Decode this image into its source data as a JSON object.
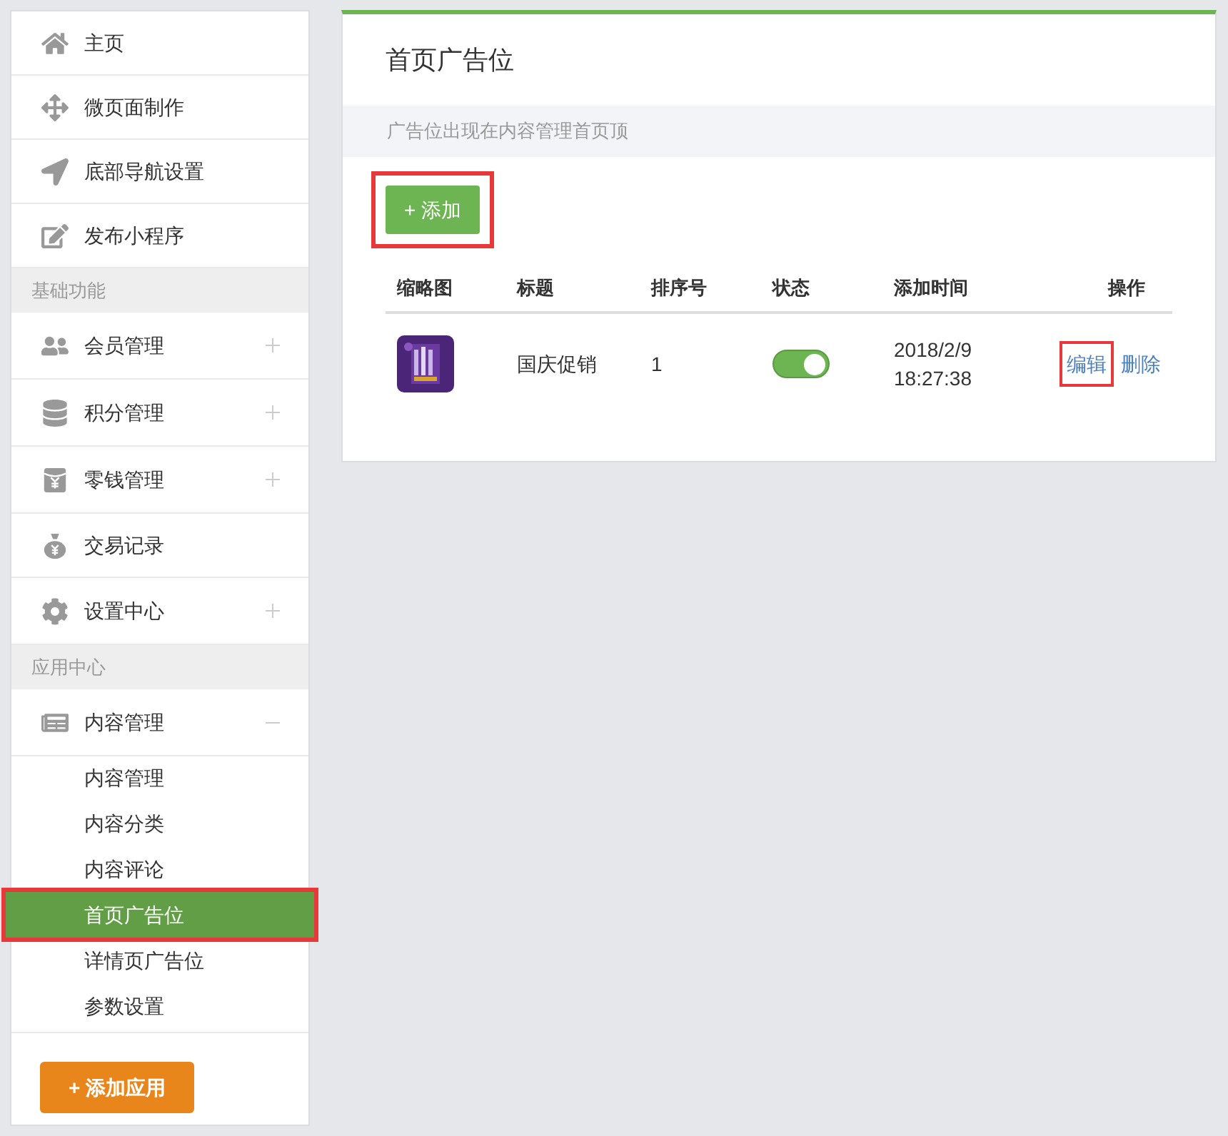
{
  "sidebar": {
    "entries": [
      {
        "kind": "item",
        "label": "主页"
      },
      {
        "kind": "item",
        "label": "微页面制作"
      },
      {
        "kind": "item",
        "label": "底部导航设置"
      },
      {
        "kind": "item",
        "label": "发布小程序"
      },
      {
        "kind": "section",
        "label": "基础功能"
      },
      {
        "kind": "item",
        "label": "会员管理",
        "expanded": false
      },
      {
        "kind": "item",
        "label": "积分管理",
        "expanded": false
      },
      {
        "kind": "item",
        "label": "零钱管理",
        "expanded": false
      },
      {
        "kind": "item",
        "label": "交易记录"
      },
      {
        "kind": "item",
        "label": "设置中心",
        "expanded": false
      },
      {
        "kind": "section",
        "label": "应用中心"
      },
      {
        "kind": "item",
        "label": "内容管理",
        "expanded": true,
        "children": [
          {
            "label": "内容管理",
            "selected": false,
            "highlighted": false
          },
          {
            "label": "内容分类",
            "selected": false,
            "highlighted": false
          },
          {
            "label": "内容评论",
            "selected": false,
            "highlighted": false
          },
          {
            "label": "首页广告位",
            "selected": true,
            "highlighted": true
          },
          {
            "label": "详情页广告位",
            "selected": false,
            "highlighted": false
          },
          {
            "label": "参数设置",
            "selected": false,
            "highlighted": false
          }
        ]
      }
    ],
    "add_app_button": "+ 添加应用"
  },
  "main": {
    "title": "首页广告位",
    "notice": "广告位出现在内容管理首页顶",
    "add_button": {
      "label": "+ 添加",
      "highlighted": true
    },
    "table": {
      "columns": [
        "缩略图",
        "标题",
        "排序号",
        "状态",
        "添加时间",
        "操作"
      ],
      "rows": [
        {
          "title": "国庆促销",
          "order": "1",
          "on": true,
          "date": "2018/2/9",
          "time": "18:27:38",
          "actions": [
            {
              "label": "编辑",
              "highlighted": true
            },
            {
              "label": "删除",
              "highlighted": false
            }
          ]
        }
      ]
    }
  }
}
